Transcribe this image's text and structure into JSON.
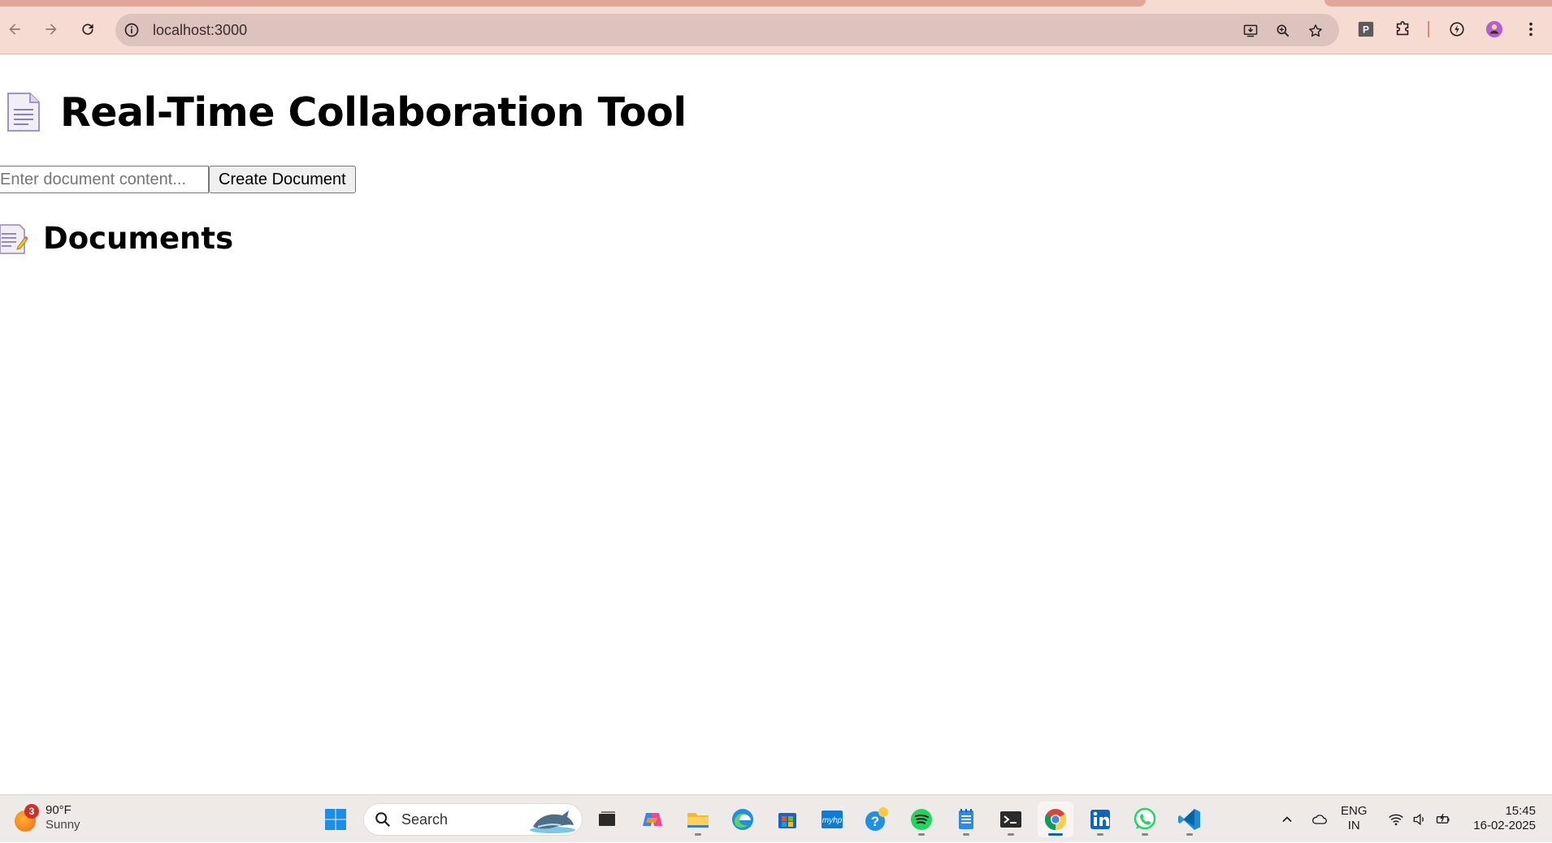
{
  "browser": {
    "url": "localhost:3000"
  },
  "page": {
    "title_icon": "page-facing-up-emoji",
    "title": "Real-Time Collaboration Tool",
    "input": {
      "placeholder": "Enter document content...",
      "value": ""
    },
    "create_button_label": "Create Document",
    "documents_icon": "memo-emoji",
    "documents_heading": "Documents"
  },
  "taskbar": {
    "weather": {
      "badge": "3",
      "temp": "90°F",
      "condition": "Sunny"
    },
    "search_label": "Search",
    "apps": [
      "start",
      "task-view",
      "copilot",
      "file-explorer",
      "edge",
      "store",
      "myhp",
      "get-help",
      "spotify",
      "notepad",
      "terminal",
      "chrome",
      "linkedin",
      "whatsapp",
      "vscode"
    ],
    "language": {
      "line1": "ENG",
      "line2": "IN"
    },
    "clock": {
      "time": "15:45",
      "date": "16-02-2025"
    }
  }
}
